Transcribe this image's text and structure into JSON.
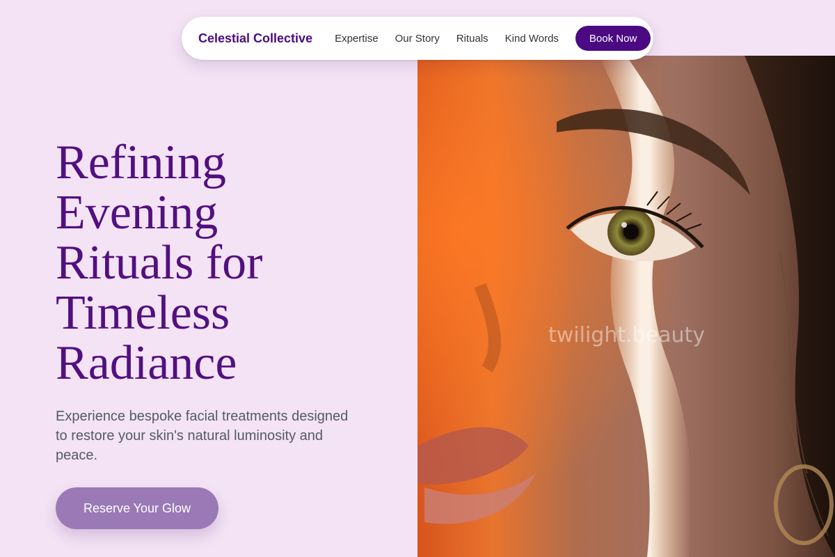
{
  "nav": {
    "brand": "Celestial Collective",
    "links": [
      "Expertise",
      "Our Story",
      "Rituals",
      "Kind Words"
    ],
    "cta": "Book Now"
  },
  "hero": {
    "title_lines": [
      "Refining",
      "Evening",
      "Rituals for",
      "Timeless",
      "Radiance"
    ],
    "subtitle": "Experience bespoke facial treatments designed to restore your skin's natural luminosity and peace.",
    "cta": "Reserve Your Glow"
  },
  "photo": {
    "subject": "close-up portrait of a woman's face with a streak of warm light across it",
    "watermark": "twilight.beauty"
  },
  "colors": {
    "background": "#f3e3f5",
    "brand": "#4a0c7d",
    "heading": "#52107f",
    "button_primary": "#4b0a82",
    "button_secondary": "#9a79b6",
    "body_text": "#555a63"
  }
}
